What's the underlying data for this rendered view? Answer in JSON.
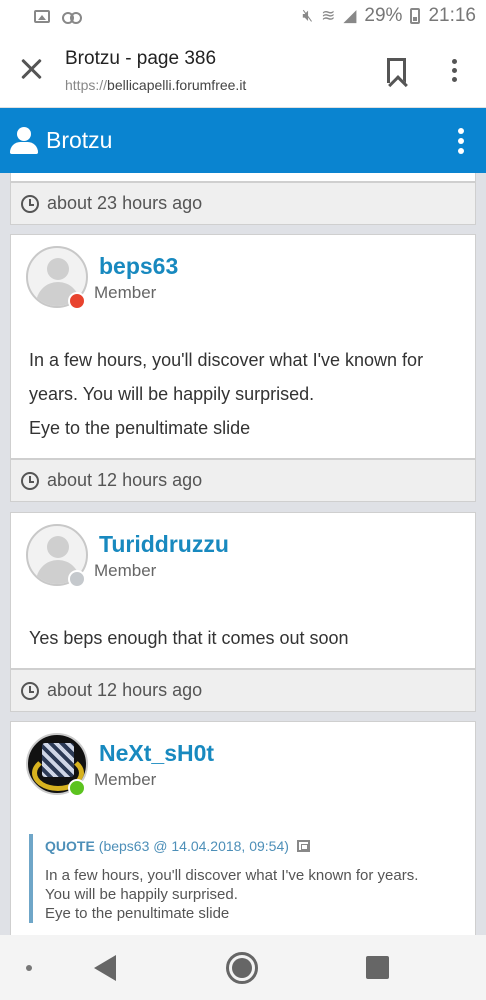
{
  "status_bar": {
    "battery": "29%",
    "time": "21:16"
  },
  "browser": {
    "title": "Brotzu - page 386",
    "url_scheme": "https://",
    "url_host": "bellicapelli.forumfree.it"
  },
  "forum": {
    "title": "Brotzu"
  },
  "top_footer": {
    "time": "about 23 hours ago"
  },
  "posts": [
    {
      "username": "beps63",
      "role": "Member",
      "status_color": "#e8432e",
      "lines": [
        "In a few hours, you'll discover what I've known for",
        "years. You will be happily surprised.",
        "Eye to the penultimate slide"
      ],
      "time": "about 12 hours ago"
    },
    {
      "username": "Turiddruzzu",
      "role": "Member",
      "status_color": "#c5c9cd",
      "lines": [
        "Yes beps enough that it comes out soon"
      ],
      "time": "about 12 hours ago"
    },
    {
      "username": "NeXt_sH0t",
      "role": "Member",
      "status_color": "#5cc31f",
      "quote": {
        "label": "QUOTE",
        "meta": "(beps63 @ 14.04.2018, 09:54)",
        "lines": [
          "In a few hours, you'll discover what I've known for years.",
          "You will be happily surprised.",
          "Eye to the penultimate slide"
        ]
      }
    }
  ],
  "icons": {
    "status": [
      "image-icon",
      "voicemail-icon",
      "mute-icon",
      "wifi-icon",
      "signal-icon",
      "battery-icon"
    ],
    "browser": [
      "close-icon",
      "bookmark-icon",
      "more-vert-icon"
    ],
    "forum": [
      "user-icon",
      "more-vert-icon"
    ],
    "nav": [
      "nav-dot-icon",
      "back-icon",
      "home-icon",
      "recent-apps-icon"
    ]
  }
}
